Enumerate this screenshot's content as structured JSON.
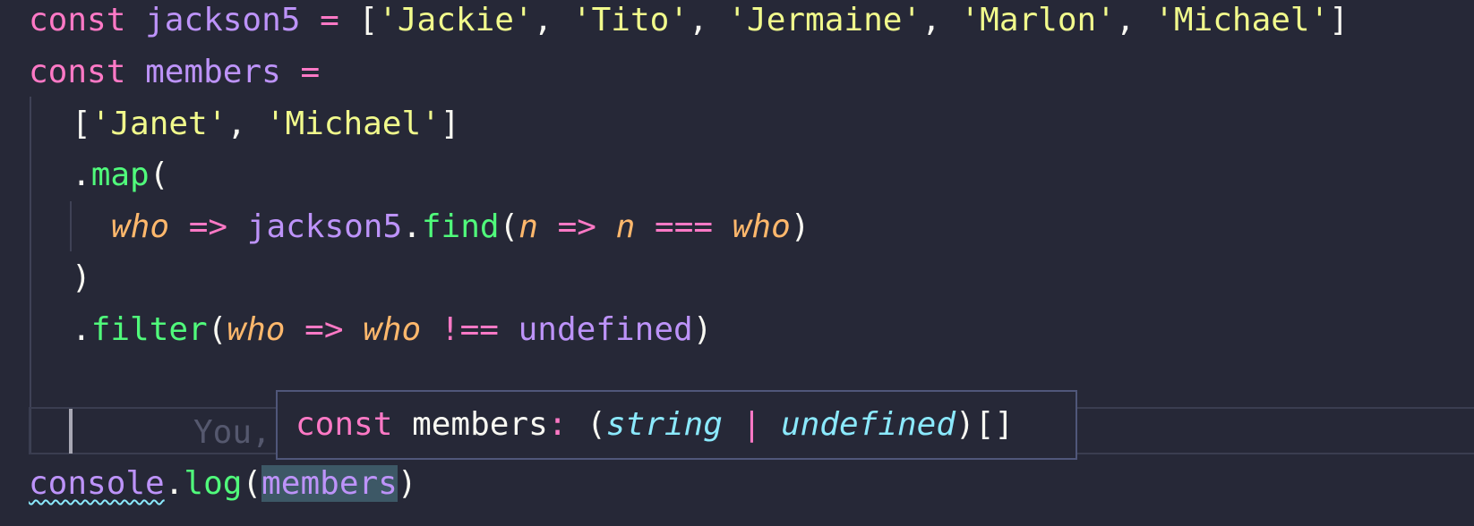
{
  "code": {
    "line1": {
      "kw": "const",
      "name": "jackson5",
      "eq": "=",
      "open": "[",
      "s1": "'Jackie'",
      "s2": "'Tito'",
      "s3": "'Jermaine'",
      "s4": "'Marlon'",
      "s5": "'Michael'",
      "close": "]"
    },
    "line2": {
      "kw": "const",
      "name": "members",
      "eq": "="
    },
    "line3": {
      "open": "[",
      "s1": "'Janet'",
      "s2": "'Michael'",
      "close": "]"
    },
    "line4": {
      "dot": ".",
      "fn": "map",
      "paren": "("
    },
    "line5": {
      "p1": "who",
      "arrow1": "=>",
      "obj": "jackson5",
      "dot": ".",
      "fn": "find",
      "paren_open": "(",
      "p2": "n",
      "arrow2": "=>",
      "p3": "n",
      "op": "===",
      "p4": "who",
      "paren_close": ")"
    },
    "line6": {
      "paren": ")"
    },
    "line7": {
      "dot": ".",
      "fn": "filter",
      "paren_open": "(",
      "p1": "who",
      "arrow": "=>",
      "p2": "who",
      "op": "!==",
      "undef": "undefined",
      "paren_close": ")"
    },
    "line9": {
      "ghost": "You,"
    },
    "line10": {
      "obj": "console",
      "dot": ".",
      "fn": "log",
      "paren_open": "(",
      "arg": "members",
      "paren_close": ")"
    }
  },
  "hover": {
    "kw": "const",
    "name": "members",
    "colon": ":",
    "open": "(",
    "type1": "string",
    "pipe": "|",
    "type2": "undefined",
    "close": ")[]"
  },
  "colors": {
    "background": "#262837",
    "keyword": "#ff79c6",
    "variable": "#bd93f9",
    "string": "#f1fa8c",
    "function": "#50fa7b",
    "parameter": "#ffb86c",
    "type": "#8be9fd"
  }
}
